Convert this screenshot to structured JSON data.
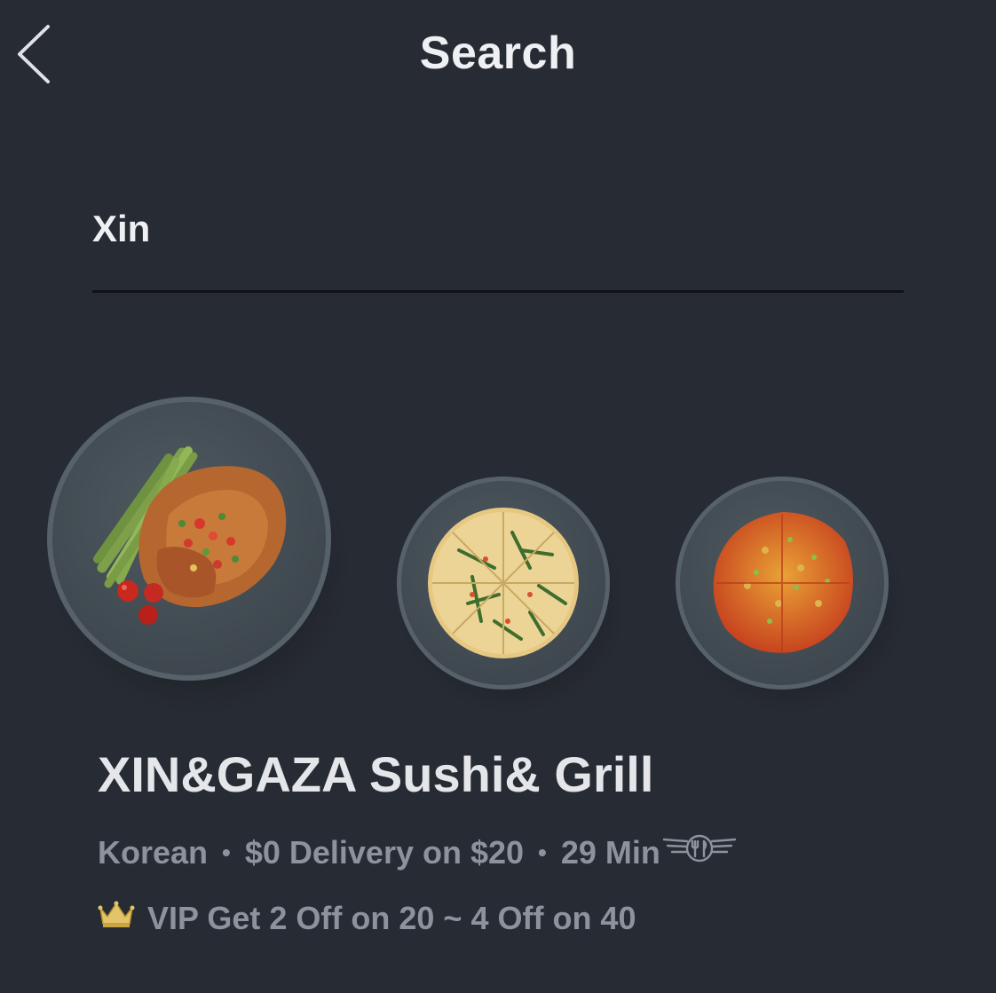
{
  "header": {
    "title": "Search",
    "back_icon": "chevron-left-icon"
  },
  "search": {
    "value": "Xin",
    "placeholder": ""
  },
  "restaurant": {
    "name": "XIN&GAZA Sushi& Grill",
    "cuisine": "Korean",
    "delivery": "$0 Delivery on $20",
    "time": "29 Min",
    "separator": "•",
    "badge_icon": "winged-cutlery-icon",
    "promo_icon": "crown-icon",
    "promo": "VIP Get 2 Off on 20 ~ 4 Off on 40",
    "dishes": [
      {
        "name": "grilled-chicken-asparagus",
        "icon": "dish-image"
      },
      {
        "name": "scallion-pancake",
        "icon": "dish-image"
      },
      {
        "name": "kimchi-pancake",
        "icon": "dish-image"
      }
    ]
  },
  "colors": {
    "background": "#272b33",
    "plate": "#48525a",
    "title_text": "#eef0f3",
    "muted_text": "#8d939c",
    "crown": "#e3c46a"
  }
}
